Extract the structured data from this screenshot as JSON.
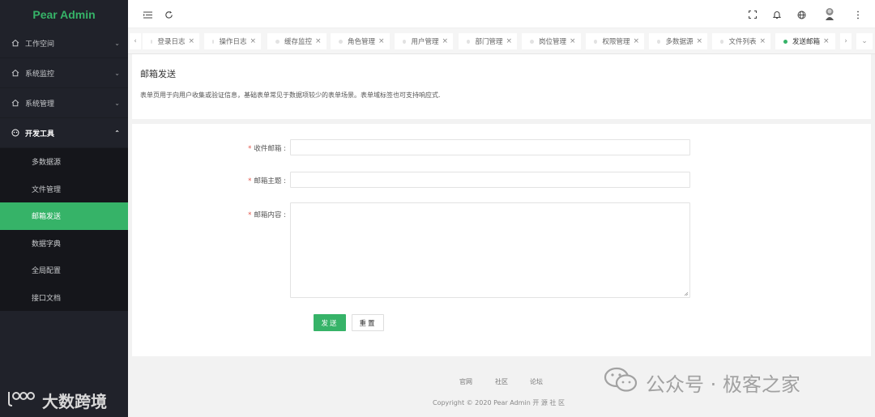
{
  "app": {
    "logo_text": "Pear Admin",
    "accent": "#36b368"
  },
  "sidebar": {
    "items": [
      {
        "label": "工作空间",
        "icon": "home-icon"
      },
      {
        "label": "系统监控",
        "icon": "home-icon"
      },
      {
        "label": "系统管理",
        "icon": "home-icon"
      },
      {
        "label": "开发工具",
        "icon": "gauge-icon"
      }
    ],
    "sub_items": [
      {
        "label": "多数据源"
      },
      {
        "label": "文件管理"
      },
      {
        "label": "邮箱发送"
      },
      {
        "label": "数据字典"
      },
      {
        "label": "全局配置"
      },
      {
        "label": "接口文档"
      }
    ],
    "watermark": {
      "logo": "ɩᵀᴼᴼ",
      "text": "大数跨境"
    }
  },
  "tabs": [
    {
      "label": "登录日志",
      "close": "×"
    },
    {
      "label": "操作日志",
      "close": "×"
    },
    {
      "label": "缓存监控",
      "close": "×"
    },
    {
      "label": "角色管理",
      "close": "×"
    },
    {
      "label": "用户管理",
      "close": "×"
    },
    {
      "label": "部门管理",
      "close": "×"
    },
    {
      "label": "岗位管理",
      "close": "×"
    },
    {
      "label": "权限管理",
      "close": "×"
    },
    {
      "label": "多数据源",
      "close": "×"
    },
    {
      "label": "文件列表",
      "close": "×"
    },
    {
      "label": "发送邮箱",
      "close": "×"
    }
  ],
  "page": {
    "title": "邮箱发送",
    "description": "表单页用于向用户收集或验证信息，基础表单常见于数据项较少的表单场景。表单域标签也可支持响应式."
  },
  "form": {
    "required_mark": "*",
    "to_label": "收件邮箱 :",
    "subject_label": "邮箱主题 :",
    "content_label": "邮箱内容 :",
    "to_value": "",
    "subject_value": "",
    "content_value": "",
    "submit_label": "发送",
    "reset_label": "重置"
  },
  "footer": {
    "links": [
      "官网",
      "社区",
      "论坛"
    ],
    "copyright": "Copyright © 2020   Pear Admin 开 源 社 区"
  },
  "watermark_right": {
    "text": "公众号 · 极客之家"
  }
}
